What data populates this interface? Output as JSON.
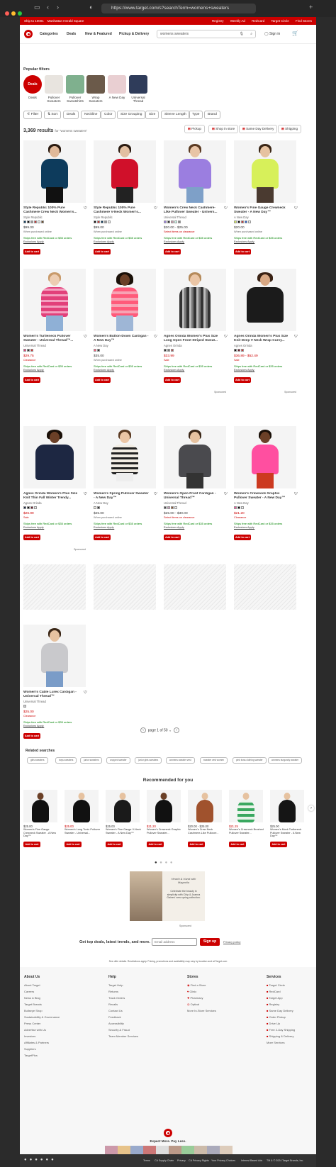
{
  "browser": {
    "url": "https://www.target.com/s?searchTerm=womens+sweaters"
  },
  "topbar": {
    "ship_to": "Ship to 10001",
    "store": "Manhattan Herald Square",
    "links": [
      "Registry",
      "Weekly Ad",
      "RedCard",
      "Target Circle",
      "Find Stores"
    ]
  },
  "header": {
    "nav": [
      "Categories",
      "Deals",
      "New & Featured",
      "Pickup & Delivery"
    ],
    "search_value": "womens sweaters",
    "signin": "Sign in"
  },
  "popular_filters": {
    "title": "Popular filters",
    "items": [
      "Deals",
      "Pullover Sweaters",
      "Pullover Sweatshirts",
      "Wrap Sweaters",
      "A New Day",
      "Universal Thread"
    ]
  },
  "filter_chips": [
    "Filter",
    "Sort",
    "Deals",
    "Neckline",
    "Color",
    "Size Grouping",
    "Size",
    "Sleeve Length",
    "Type",
    "Brand"
  ],
  "results": {
    "count": "3,369 results",
    "for": "for \"womens sweaters\""
  },
  "fulfillment": [
    "Pickup",
    "Shop in store",
    "Same Day Delivery",
    "Shipping"
  ],
  "products": [
    {
      "title": "Style Republic 100% Pure Cashmere Crew Neck Women's...",
      "brand": "Style Republic",
      "price": "$99.00",
      "note": "When purchased online",
      "ship": "Ships free with RedCard or $35 orders",
      "exc": "Exclusions Apply.",
      "atc": "Add to cart"
    },
    {
      "title": "Style Republic 100% Pure Cashmere V-Neck Women's...",
      "brand": "Style Republic",
      "price": "$99.00",
      "note": "When purchased online",
      "ship": "Ships free with RedCard or $35 orders",
      "exc": "Exclusions Apply.",
      "atc": "Add to cart"
    },
    {
      "title": "Women's Crew Neck Cashmere-Like Pullover Sweater - Univers...",
      "brand": "Universal Thread",
      "price": "$20.00 - $25.00",
      "note": "Select items on clearance",
      "ship": "Ships free with RedCard or $35 orders",
      "exc": "Exclusions Apply.",
      "atc": "Add to cart"
    },
    {
      "title": "Women's Fine Gauge Crewneck Sweater - A New Day™",
      "brand": "A New Day",
      "price": "$20.00",
      "note": "When purchased online",
      "ship": "Ships free with RedCard or $35 orders",
      "exc": "Exclusions Apply.",
      "atc": "Add to cart"
    },
    {
      "title": "Women's Turtleneck Pullover Sweater - Universal Thread™...",
      "brand": "Universal Thread",
      "price": "$29.75",
      "note": "Clearance",
      "ship": "Ships free with RedCard or $35 orders",
      "exc": "Exclusions Apply.",
      "atc": "Add to cart"
    },
    {
      "title": "Women's Button-Down Cardigan - A New Day™",
      "brand": "A New Day",
      "price": "$35.00",
      "note": "When purchased online",
      "ship": "Ships free with RedCard or $35 orders",
      "exc": "Exclusions Apply.",
      "atc": "Add to cart"
    },
    {
      "title": "Agnes Orinda Women's Plus Size Long Open Front Striped Sweat...",
      "brand": "Agnes Orinda",
      "price": "$33.99",
      "note": "Sale",
      "ship": "Ships free with RedCard or $35 orders",
      "exc": "Exclusions Apply.",
      "atc": "Add to cart",
      "sponsored": "Sponsored"
    },
    {
      "title": "Agnes Orinda Women's Plus Size Knit Deep V Neck Wrap Curvy...",
      "brand": "Agnes Orinda",
      "price": "$36.89 - $52.49",
      "note": "Sale",
      "ship": "Ships free with RedCard or $35 orders",
      "exc": "Exclusions Apply.",
      "atc": "Add to cart",
      "sponsored": "Sponsored"
    },
    {
      "title": "Agnes Orinda Women's Plus Size Knit Thin Fall Winter Trendy...",
      "brand": "Agnes Orinda",
      "price": "$26.99",
      "note": "Sale",
      "ship": "Ships free with RedCard or $35 orders",
      "exc": "Exclusions Apply.",
      "atc": "Add to cart",
      "sponsored": "Sponsored"
    },
    {
      "title": "Women's Spring Pullover Sweater - A New Day™",
      "brand": "A New Day",
      "price": "$25.00",
      "note": "When purchased online",
      "ship": "Ships free with RedCard or $35 orders",
      "exc": "Exclusions Apply.",
      "atc": "Add to cart"
    },
    {
      "title": "Women's Open-Front Cardigan - Universal Thread™",
      "brand": "Universal Thread",
      "price": "$25.00 - $30.00",
      "note": "Select items on clearance",
      "ship": "Ships free with RedCard or $35 orders",
      "exc": "Exclusions Apply.",
      "atc": "Add to cart"
    },
    {
      "title": "Women's Crewneck Graphic Pullover Sweater - A New Day™",
      "brand": "A New Day",
      "price": "$21.20",
      "note": "Clearance",
      "ship": "Ships free with RedCard or $35 orders",
      "exc": "Exclusions Apply.",
      "atc": "Add to cart"
    },
    {
      "title": "Women's Cable Lurex Cardigan - Universal Thread™",
      "brand": "Universal Thread",
      "price": "$25.00",
      "note": "Clearance",
      "ship": "Ships free with RedCard or $35 orders",
      "exc": "Exclusions Apply.",
      "atc": "Add to cart"
    }
  ],
  "pager": {
    "label": "page 1 of 50"
  },
  "related": {
    "title": "Related searches",
    "items": [
      "girls sweaters",
      "boys sweaters",
      "junior sweaters",
      "cropped sweater",
      "junior girls sweaters",
      "womens sweater vest",
      "sweater vest women",
      "pink truss clothing sweater",
      "womens burgundy sweater"
    ]
  },
  "recommended": {
    "title": "Recommended for you",
    "items": [
      {
        "price": "$25.00",
        "title": "Women's Fine Gauge Crewneck Sweater - A New Day™"
      },
      {
        "price": "$25.00",
        "title": "Women's Long Tunic Pullover Sweater - Universal..."
      },
      {
        "price": "$25.00",
        "title": "Women's Fine Gauge V-Neck Sweater - A New Day™"
      },
      {
        "price": "$21.20",
        "title": "Women's Crewneck Graphic Pullover Sweater..."
      },
      {
        "price": "$20.00 - $25.00",
        "title": "Women's Crew Neck Cashmere-Like Pullover..."
      },
      {
        "price": "$21.25",
        "title": "Women's Crewneck Brushed Pullover Sweater..."
      },
      {
        "price": "$25.00",
        "title": "Women's Mock Turtleneck Pullover Sweater - A New Day™"
      }
    ],
    "atc": "Add to cart"
  },
  "ad": {
    "brand": "Hearth & Hand with Magnolia",
    "text": "Celebrate the beauty in simplicity with Chip & Joanna Gaines' new spring collection.",
    "sponsored": "Sponsored"
  },
  "newsletter": {
    "text": "Get top deals, latest trends, and more.",
    "placeholder": "Email address",
    "button": "Sign up",
    "policy": "Privacy policy"
  },
  "offer_details": "See offer details. Restrictions apply. Pricing, promotions and availability may vary by location and at Target.com",
  "footer": {
    "about": {
      "title": "About Us",
      "links": [
        "About Target",
        "Careers",
        "News & Blog",
        "Target Brands",
        "Bullseye Shop",
        "Sustainability & Governance",
        "Press Center",
        "Advertise with Us",
        "Investors",
        "Affiliates & Partners",
        "Suppliers",
        "TargetPlus"
      ]
    },
    "help": {
      "title": "Help",
      "links": [
        "Target Help",
        "Returns",
        "Track Orders",
        "Recalls",
        "Contact Us",
        "Feedback",
        "Accessibility",
        "Security & Fraud",
        "Team Member Services"
      ]
    },
    "stores": {
      "title": "Stores",
      "links": [
        "Find a Store",
        "Clinic",
        "Pharmacy",
        "Optical",
        "More In-Store Services"
      ]
    },
    "services": {
      "title": "Services",
      "links": [
        "Target Circle",
        "RedCard",
        "Target App",
        "Registry",
        "Same Day Delivery",
        "Order Pickup",
        "Drive Up",
        "Free 2-Day Shipping",
        "Shipping & Delivery",
        "More Services"
      ]
    },
    "tagline": "Expect More. Pay Less.",
    "bottom_links": [
      "Terms",
      "CA Supply Chain",
      "Privacy",
      "CA Privacy Rights",
      "Your Privacy Choices",
      "Interest Based Ads"
    ],
    "copyright": "TM & © 2024 Target Brands, Inc."
  }
}
